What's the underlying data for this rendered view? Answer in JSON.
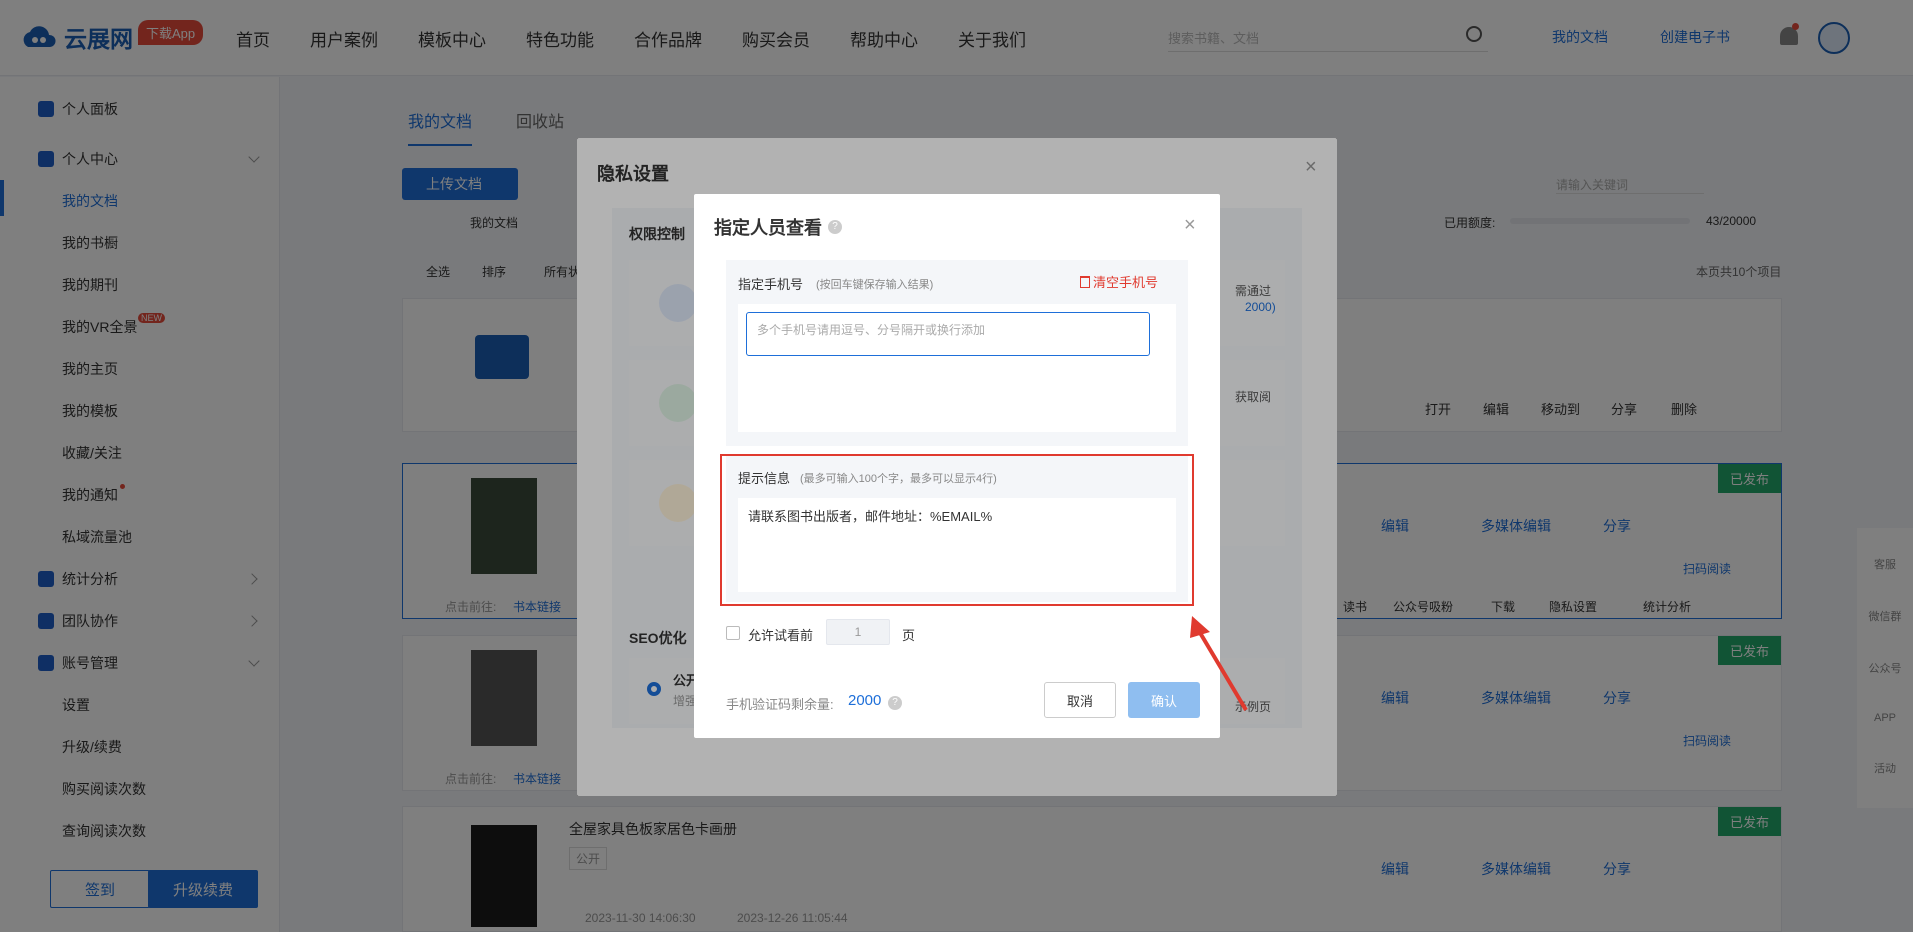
{
  "topnav": {
    "logo": "云展网",
    "app_badge": "下载App",
    "nav_items": [
      "首页",
      "用户案例",
      "模板中心",
      "特色功能",
      "合作品牌",
      "购买会员",
      "帮助中心",
      "关于我们"
    ],
    "search_placeholder": "搜索书籍、文档",
    "my_docs": "我的文档",
    "create_ebook": "创建电子书"
  },
  "sidebar": {
    "dashboard": "个人面板",
    "personal_center": "个人中心",
    "items": [
      "我的文档",
      "我的书橱",
      "我的期刊",
      "我的VR全景",
      "我的主页",
      "我的模板",
      "收藏/关注",
      "我的通知",
      "私域流量池"
    ],
    "vr_new_badge": "NEW",
    "stats": "统计分析",
    "team": "团队协作",
    "account": "账号管理",
    "account_items": [
      "设置",
      "升级/续费",
      "购买阅读次数",
      "查询阅读次数"
    ],
    "sign_btn": "签到",
    "vip_btn": "升级续费"
  },
  "main": {
    "tabs": [
      "我的文档",
      "回收站"
    ],
    "upload_btn": "上传文档",
    "breadcrumb": "我的文档",
    "select_all": "全选",
    "sort": "排序",
    "filter": "所有状",
    "search_placeholder": "请输入关键词",
    "quota_label": "已用额度:",
    "quota_value": "43/20000",
    "page_count": "本页共10个项目",
    "folder_actions": [
      "打开",
      "编辑",
      "移动到",
      "分享",
      "删除"
    ],
    "published_tag": "已发布",
    "book_actions": [
      "编辑",
      "多媒体编辑",
      "分享"
    ],
    "book_sub_actions": [
      "读书",
      "公众号吸粉",
      "下载",
      "隐私设置",
      "统计分析"
    ],
    "scan_read": "扫码阅读",
    "new_badge": "NEW",
    "link_prefix": "点击前往:",
    "link_text": "书本链接",
    "book3_title": "全屋家具色板家居色卡画册",
    "public_tag": "公开",
    "book3_created": "2023-11-30 14:06:30",
    "book3_updated": "2023-12-26 11:05:44",
    "right_float": [
      "客服",
      "微信群",
      "公众号",
      "APP",
      "活动"
    ]
  },
  "privacy_dialog": {
    "title": "隐私设置",
    "permission_label": "权限控制",
    "perm_note": "需通过",
    "perm_limit": "2000)",
    "perm_note2": "获取阅",
    "seo_label": "SEO优化",
    "seo_option": "公开",
    "seo_hint": "增强",
    "seo_right": "示例页"
  },
  "designated_dialog": {
    "title": "指定人员查看",
    "phone_label": "指定手机号",
    "phone_hint": "(按回车键保存输入结果)",
    "clear_phones": "清空手机号",
    "phone_placeholder": "多个手机号请用逗号、分号隔开或换行添加",
    "tip_label": "提示信息",
    "tip_hint": "(最多可输入100个字，最多可以显示4行)",
    "tip_value": "请联系图书出版者，邮件地址：%EMAIL%",
    "allow_preview": "允许试看前",
    "preview_pages": "1",
    "page_unit": "页",
    "sms_label": "手机验证码剩余量:",
    "sms_value": "2000",
    "cancel": "取消",
    "confirm": "确认"
  },
  "colors": {
    "primary": "#1e6fd9",
    "highlight_frame": "#e03a2f",
    "published": "#22a86b"
  }
}
